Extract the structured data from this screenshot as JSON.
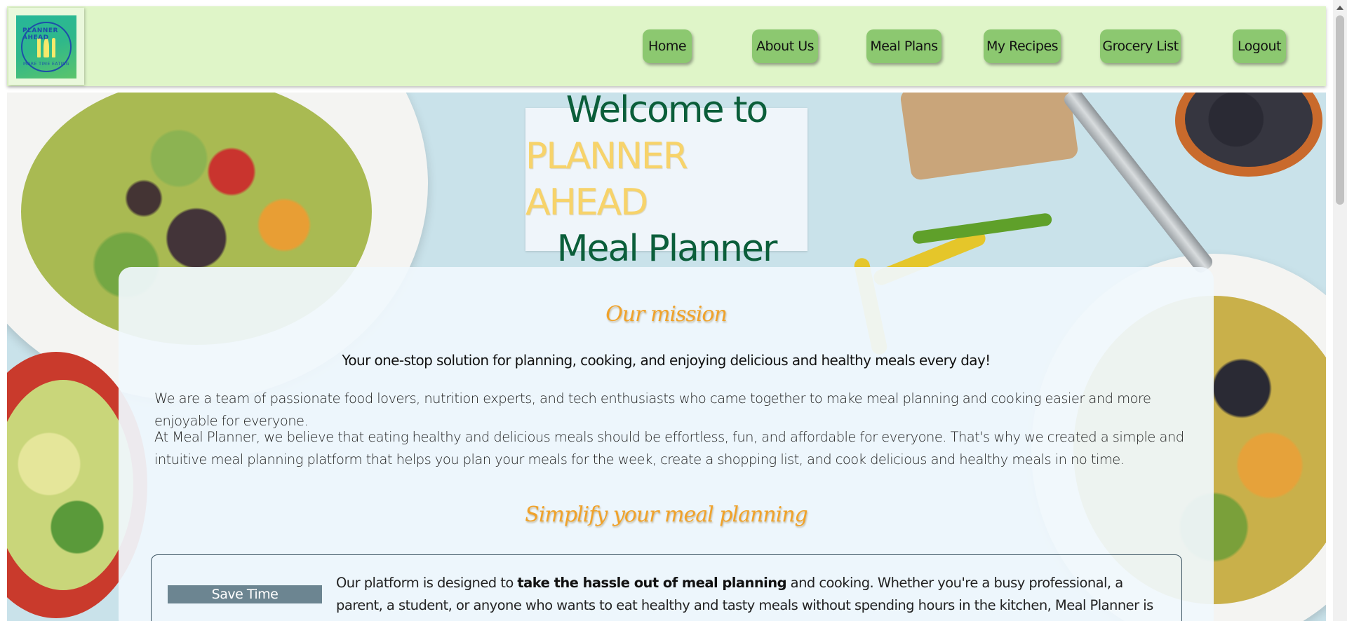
{
  "nav": {
    "logo": {
      "top_text": "PLANNER AHEAD",
      "bottom_text": "MORE TIME EATING"
    },
    "items": [
      {
        "label": "Home"
      },
      {
        "label": "About Us"
      },
      {
        "label": "Meal Plans"
      },
      {
        "label": "My Recipes"
      },
      {
        "label": "Grocery List"
      },
      {
        "label": "Logout"
      }
    ]
  },
  "hero": {
    "title_line1": "Welcome to",
    "title_brand": "PLANNER AHEAD",
    "title_line3": "Meal Planner"
  },
  "content": {
    "mission_heading": "Our mission",
    "lead": "Your one-stop solution for planning, cooking, and enjoying delicious and healthy meals every day!",
    "para1": "We are a team of passionate food lovers, nutrition experts, and tech enthusiasts who came together to make meal planning and cooking easier and more enjoyable for everyone.",
    "para2": "At Meal Planner, we believe that eating healthy and delicious meals should be effortless, fun, and affordable for everyone. That's why we created a simple and intuitive meal planning platform that helps you plan your meals for the week, create a shopping list, and cook delicious and healthy meals in no time.",
    "simplify_heading": "Simplify your meal planning",
    "feature": {
      "button_label": "Save Time",
      "text_before": "Our platform is designed to ",
      "text_bold": "take the hassle out of meal planning",
      "text_after": " and cooking. Whether you're a busy professional, a parent, a student, or anyone who wants to eat healthy and tasty meals without spending hours in the kitchen, Meal Planner is the perfect solution for you."
    }
  },
  "colors": {
    "nav_bg": "#dff5c8",
    "nav_button": "#8cc870",
    "title_green": "#0b5e3a",
    "title_yellow": "#f7d36a",
    "heading_orange": "#f0a22a",
    "save_button": "#6c8591"
  }
}
